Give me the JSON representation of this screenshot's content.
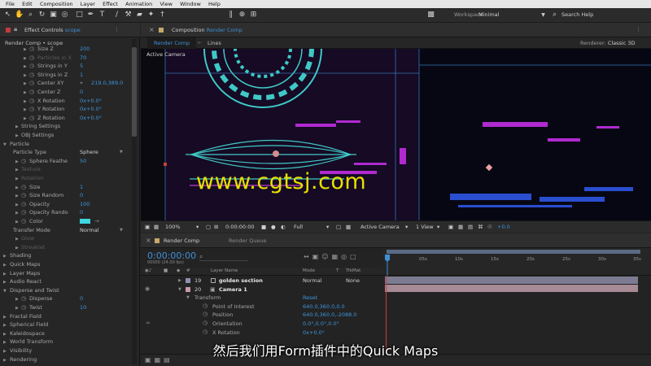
{
  "menubar": {
    "items": [
      "File",
      "Edit",
      "Composition",
      "Layer",
      "Effect",
      "Animation",
      "View",
      "Window",
      "Help"
    ]
  },
  "toolbar": {
    "workspace_label": "Workspace:",
    "workspace_value": "Minimal",
    "search_help": "Search Help"
  },
  "effect_controls": {
    "tab_label": "Effect Controls",
    "tab_layer": "scope",
    "breadcrumb": "Render Comp • scope",
    "rows": [
      {
        "label": "Size Z",
        "value": "200"
      },
      {
        "label": "Particles in X",
        "value": "70",
        "dim": true
      },
      {
        "label": "Strings in Y",
        "value": "5"
      },
      {
        "label": "Strings in Z",
        "value": "1"
      },
      {
        "label": "Center XY",
        "value": "219.0,389.0"
      },
      {
        "label": "Center Z",
        "value": "0"
      },
      {
        "label": "X Rotation",
        "value": "0x+0.0°"
      },
      {
        "label": "Y Rotation",
        "value": "0x+0.0°"
      },
      {
        "label": "Z Rotation",
        "value": "0x+0.0°"
      },
      {
        "label": "String Settings",
        "value": ""
      },
      {
        "label": "OBJ Settings",
        "value": ""
      },
      {
        "label": "Particle",
        "value": ""
      },
      {
        "label": "Particle Type",
        "value": "Sphere"
      },
      {
        "label": "Sphere Feathe",
        "value": "50"
      },
      {
        "label": "Texture",
        "value": "",
        "dim": true
      },
      {
        "label": "Rotation",
        "value": "",
        "dim": true
      },
      {
        "label": "Size",
        "value": "1"
      },
      {
        "label": "Size Random",
        "value": "0"
      },
      {
        "label": "Opacity",
        "value": "100"
      },
      {
        "label": "Opacity Rando",
        "value": "0"
      },
      {
        "label": "Color",
        "value": ""
      },
      {
        "label": "Transfer Mode",
        "value": "Normal"
      },
      {
        "label": "Glow",
        "value": "",
        "dim": true
      },
      {
        "label": "Streaklet",
        "value": "",
        "dim": true
      },
      {
        "label": "Shading",
        "value": ""
      },
      {
        "label": "Quick Maps",
        "value": ""
      },
      {
        "label": "Layer Maps",
        "value": ""
      },
      {
        "label": "Audio React",
        "value": ""
      },
      {
        "label": "Disperse and Twist",
        "value": ""
      },
      {
        "label": "Disperse",
        "value": "0"
      },
      {
        "label": "Twist",
        "value": "10"
      },
      {
        "label": "Fractal Field",
        "value": ""
      },
      {
        "label": "Spherical Field",
        "value": ""
      },
      {
        "label": "Kaleidospace",
        "value": ""
      },
      {
        "label": "World Transform",
        "value": ""
      },
      {
        "label": "Visibility",
        "value": ""
      },
      {
        "label": "Rendering",
        "value": ""
      }
    ],
    "color_swatch": "#3fd7e0"
  },
  "composition": {
    "tab_label": "Composition",
    "tab_comp": "Render Comp",
    "subtabs": [
      "Render Comp",
      "Lines"
    ],
    "renderer_label": "Renderer:",
    "renderer_value": "Classic 3D",
    "view_label": "Active Camera",
    "watermark": "www.cgtsj.com",
    "viewer_bar": {
      "zoom": "100%",
      "time": "0:00:00:00",
      "resolution": "Full",
      "camera": "Active Camera",
      "views": "1 View",
      "exposure": "+0.0"
    }
  },
  "timeline": {
    "tab_label": "Render Comp",
    "queue_label": "Render Queue",
    "timecode": "0:00:00:00",
    "fps": "00000 (24.00 fps)",
    "columns": {
      "layer_name": "Layer Name",
      "mode": "Mode",
      "t": "T",
      "trkmat": "TrkMat"
    },
    "ruler_ticks": [
      "0s",
      "05s",
      "10s",
      "15s",
      "20s",
      "25s",
      "30s",
      "35s"
    ],
    "layers": [
      {
        "index": "19",
        "name": "golden section",
        "mode": "Normal",
        "trkmat": "None"
      },
      {
        "index": "20",
        "name": "Camera 1",
        "mode": "",
        "trkmat": ""
      }
    ],
    "transform": {
      "label": "Transform",
      "reset": "Reset",
      "properties": [
        {
          "label": "Point of Interest",
          "value": "640.0,360.0,0.0"
        },
        {
          "label": "Position",
          "value": "640.0,360.0,-2088.0"
        },
        {
          "label": "Orientation",
          "value": "0.0°,0.0°,0.0°"
        },
        {
          "label": "X Rotation",
          "value": "0x+0.0°"
        }
      ]
    }
  },
  "subtitle": "然后我们用Form插件中的Quick Maps"
}
